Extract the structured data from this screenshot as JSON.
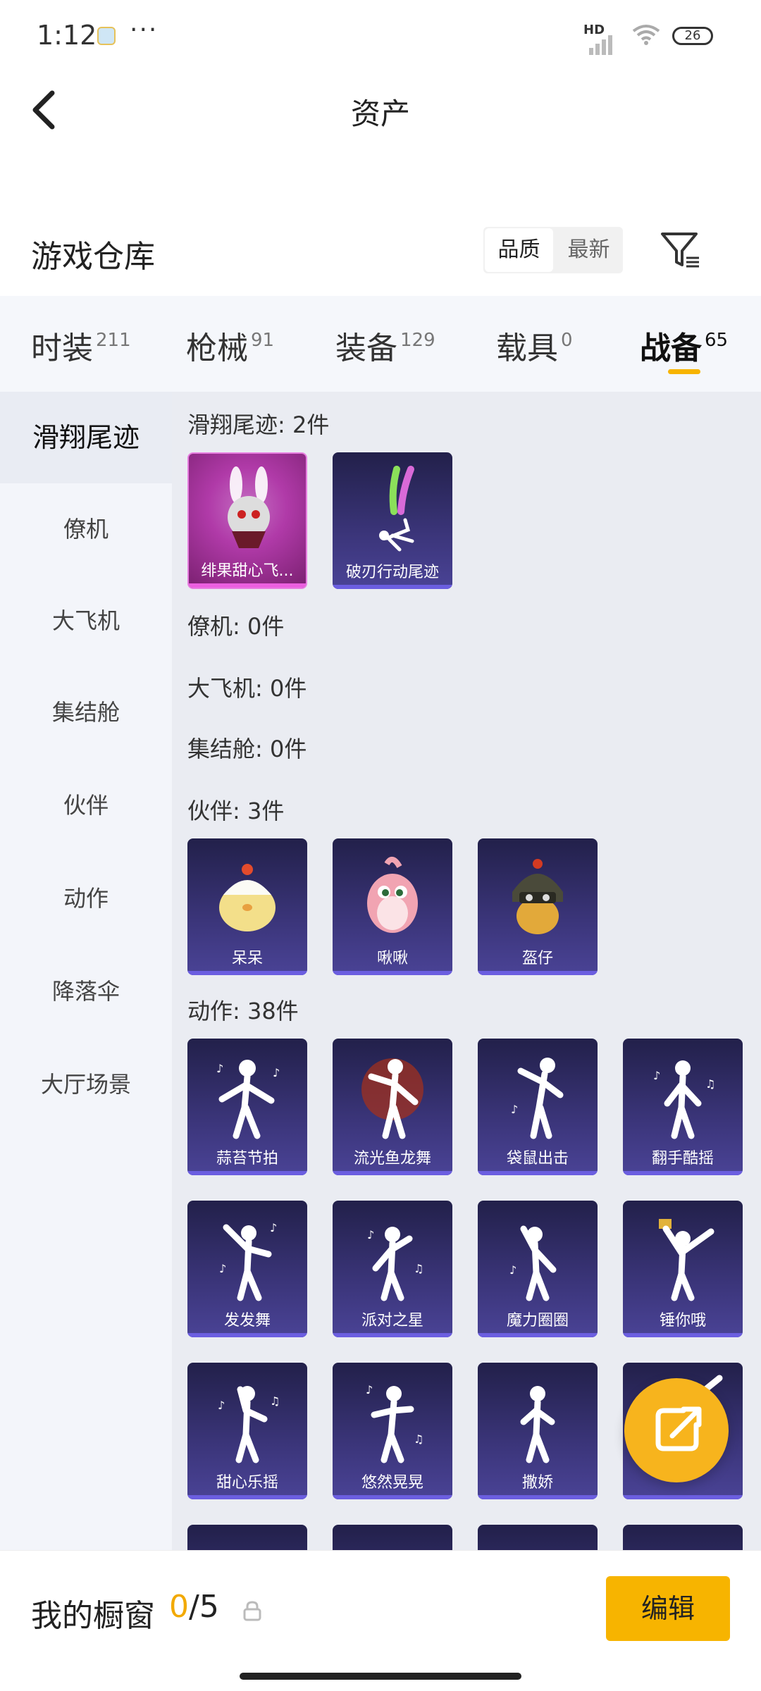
{
  "status_bar": {
    "time": "1:12",
    "more": "···",
    "hd": "HD",
    "battery": "26"
  },
  "header": {
    "title": "资产",
    "back_icon": "chevron-left-icon"
  },
  "warehouse": {
    "title": "游戏仓库",
    "sort_options": [
      "品质",
      "最新"
    ],
    "sort_selected": "品质",
    "filter_icon": "filter-icon"
  },
  "tabs": [
    {
      "label": "时装",
      "count": "211"
    },
    {
      "label": "枪械",
      "count": "91"
    },
    {
      "label": "装备",
      "count": "129"
    },
    {
      "label": "载具",
      "count": "0"
    },
    {
      "label": "战备",
      "count": "65",
      "active": true
    }
  ],
  "sidebar": [
    {
      "label": "滑翔尾迹",
      "active": true
    },
    {
      "label": "僚机"
    },
    {
      "label": "大飞机"
    },
    {
      "label": "集结舱"
    },
    {
      "label": "伙伴"
    },
    {
      "label": "动作"
    },
    {
      "label": "降落伞"
    },
    {
      "label": "大厅场景"
    }
  ],
  "groups": [
    {
      "title": "滑翔尾迹: 2件",
      "items": [
        "绯果甜心飞...",
        "破刃行动尾迹"
      ]
    },
    {
      "title": "僚机: 0件",
      "items": []
    },
    {
      "title": "大飞机: 0件",
      "items": []
    },
    {
      "title": "集结舱: 0件",
      "items": []
    },
    {
      "title": "伙伴: 3件",
      "items": [
        "呆呆",
        "啾啾",
        "盔仔"
      ]
    },
    {
      "title": "动作: 38件",
      "items": [
        "蒜苔节拍",
        "流光鱼龙舞",
        "袋鼠出击",
        "翻手酷摇",
        "发发舞",
        "派对之星",
        "魔力圈圈",
        "锤你哦",
        "甜心乐摇",
        "悠然晃晃",
        "撒娇",
        ""
      ]
    }
  ],
  "bottom": {
    "window_label": "我的橱窗",
    "window_current": "0",
    "window_total": "/5",
    "lock_icon": "lock-icon",
    "edit_label": "编辑"
  },
  "colors": {
    "accent": "#f7b400",
    "card_purple": "#3b357a",
    "card_pink": "#b03aa8"
  }
}
